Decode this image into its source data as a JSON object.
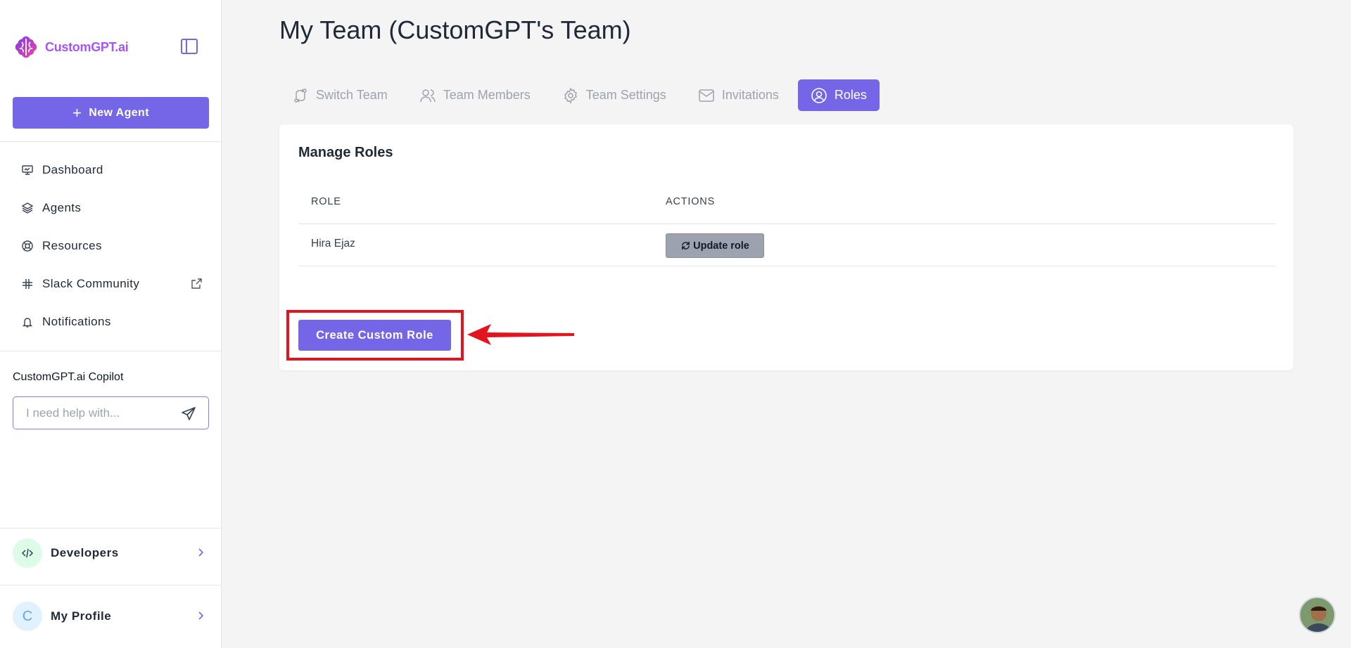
{
  "brand": {
    "name": "CustomGPT.ai",
    "color": "#a855f7",
    "accent": "#7566e8"
  },
  "sidebar": {
    "new_agent_label": "New Agent",
    "items": [
      {
        "label": "Dashboard",
        "icon": "monitor-icon"
      },
      {
        "label": "Agents",
        "icon": "layers-icon"
      },
      {
        "label": "Resources",
        "icon": "lifebuoy-icon"
      },
      {
        "label": "Slack Community",
        "icon": "slack-icon"
      },
      {
        "label": "Notifications",
        "icon": "bell-icon"
      }
    ],
    "copilot": {
      "label": "CustomGPT.ai Copilot",
      "placeholder": "I need help with..."
    },
    "developers_label": "Developers",
    "profile": {
      "label": "My Profile",
      "initial": "C"
    }
  },
  "main": {
    "title": "My Team (CustomGPT's Team)",
    "tabs": [
      {
        "label": "Switch Team",
        "active": false
      },
      {
        "label": "Team Members",
        "active": false
      },
      {
        "label": "Team Settings",
        "active": false
      },
      {
        "label": "Invitations",
        "active": false
      },
      {
        "label": "Roles",
        "active": true
      }
    ],
    "card": {
      "title": "Manage Roles",
      "columns": [
        "ROLE",
        "ACTIONS"
      ],
      "rows": [
        {
          "role": "Hira Ejaz",
          "action_label": "Update role"
        }
      ],
      "create_label": "Create Custom Role"
    }
  },
  "annotation_color": "#e3141e"
}
